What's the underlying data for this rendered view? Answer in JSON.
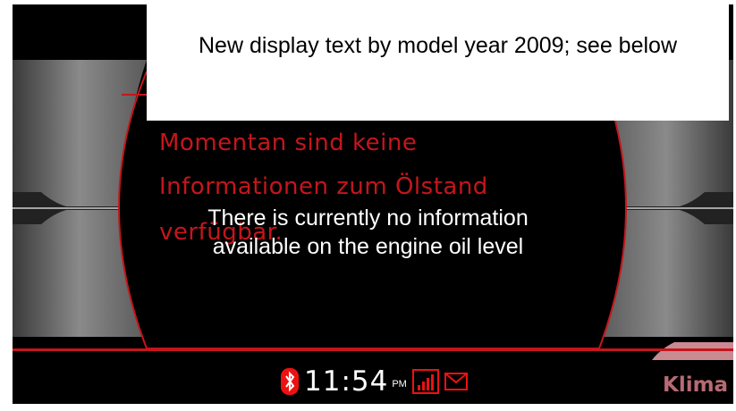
{
  "callout": {
    "text": "New display text by model year 2009; see below"
  },
  "message": {
    "lines": [
      "Momentan sind keine",
      "Informationen zum Ölstand",
      "verfügbar."
    ]
  },
  "translation": {
    "line1": "There is currently no information",
    "line2": "available on the engine oil level"
  },
  "status_bar": {
    "time": "11:54",
    "ampm": "PM",
    "icons": [
      "bluetooth-icon",
      "signal-strength-icon",
      "envelope-icon"
    ]
  },
  "softkey": {
    "label": "Klima"
  },
  "colors": {
    "accent_red": "#c4161c",
    "background": "#000000"
  }
}
